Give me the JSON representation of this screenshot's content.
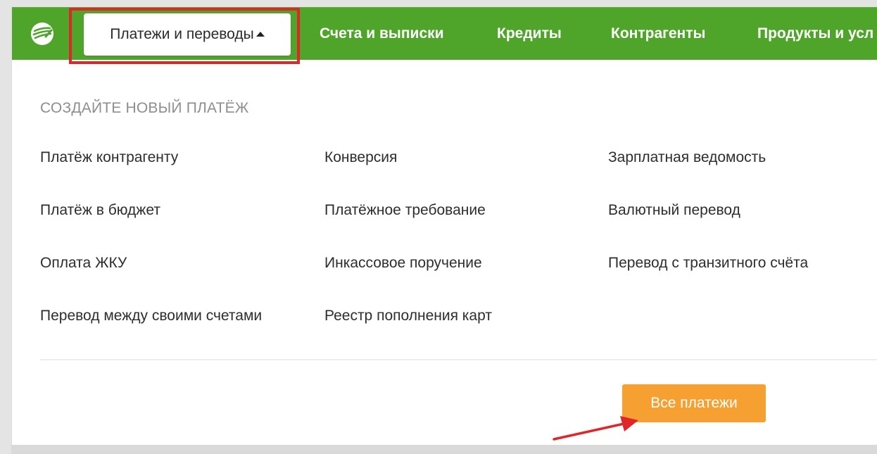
{
  "nav": {
    "active_label": "Платежи и переводы",
    "items": [
      {
        "label": "Счета и выписки"
      },
      {
        "label": "Кредиты"
      },
      {
        "label": "Контрагенты"
      },
      {
        "label": "Продукты и усл"
      }
    ]
  },
  "menu": {
    "section_title": "СОЗДАЙТЕ НОВЫЙ ПЛАТЁЖ",
    "column1": [
      "Платёж контрагенту",
      "Платёж в бюджет",
      "Оплата ЖКУ",
      "Перевод между своими счетами"
    ],
    "column2": [
      "Конверсия",
      "Платёжное требование",
      "Инкассовое поручение",
      "Реестр пополнения карт"
    ],
    "column3": [
      "Зарплатная ведомость",
      "Валютный перевод",
      "Перевод с транзитного счёта"
    ],
    "all_button_label": "Все платежи"
  },
  "icons": {
    "logo": "sberbank-logo-icon",
    "caret": "caret-up-icon",
    "annotation_arrow": "red-arrow-icon"
  },
  "colors": {
    "topbar": "#4fa52a",
    "button": "#f5a030",
    "highlight": "#e0262b"
  }
}
